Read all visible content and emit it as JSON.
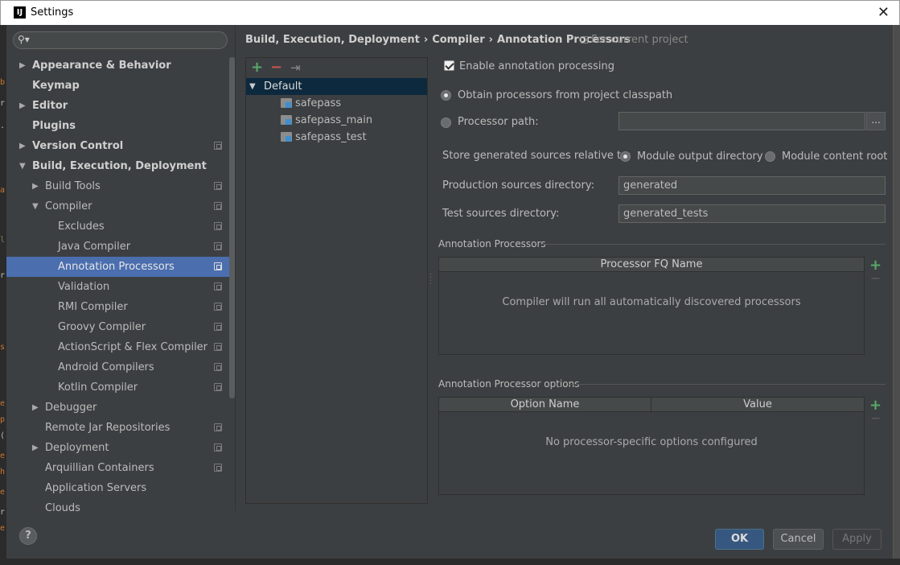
{
  "window": {
    "title": "Settings",
    "app_icon_letter": "IJ",
    "close_glyph": "✕"
  },
  "search": {
    "value": "",
    "placeholder": ""
  },
  "sidebar": {
    "items": [
      {
        "label": "Appearance & Behavior",
        "level": 0,
        "arrow": "▶",
        "bold": true,
        "project": false
      },
      {
        "label": "Keymap",
        "level": 0,
        "arrow": "",
        "bold": true,
        "project": false
      },
      {
        "label": "Editor",
        "level": 0,
        "arrow": "▶",
        "bold": true,
        "project": false
      },
      {
        "label": "Plugins",
        "level": 0,
        "arrow": "",
        "bold": true,
        "project": false
      },
      {
        "label": "Version Control",
        "level": 0,
        "arrow": "▶",
        "bold": true,
        "project": true
      },
      {
        "label": "Build, Execution, Deployment",
        "level": 0,
        "arrow": "▼",
        "bold": true,
        "project": false
      },
      {
        "label": "Build Tools",
        "level": 1,
        "arrow": "▶",
        "bold": false,
        "project": true
      },
      {
        "label": "Compiler",
        "level": 1,
        "arrow": "▼",
        "bold": false,
        "project": true
      },
      {
        "label": "Excludes",
        "level": 2,
        "arrow": "",
        "bold": false,
        "project": true
      },
      {
        "label": "Java Compiler",
        "level": 2,
        "arrow": "",
        "bold": false,
        "project": true
      },
      {
        "label": "Annotation Processors",
        "level": 2,
        "arrow": "",
        "bold": false,
        "project": true,
        "selected": true
      },
      {
        "label": "Validation",
        "level": 2,
        "arrow": "",
        "bold": false,
        "project": true
      },
      {
        "label": "RMI Compiler",
        "level": 2,
        "arrow": "",
        "bold": false,
        "project": true
      },
      {
        "label": "Groovy Compiler",
        "level": 2,
        "arrow": "",
        "bold": false,
        "project": true
      },
      {
        "label": "ActionScript & Flex Compiler",
        "level": 2,
        "arrow": "",
        "bold": false,
        "project": true
      },
      {
        "label": "Android Compilers",
        "level": 2,
        "arrow": "",
        "bold": false,
        "project": true
      },
      {
        "label": "Kotlin Compiler",
        "level": 2,
        "arrow": "",
        "bold": false,
        "project": true
      },
      {
        "label": "Debugger",
        "level": 1,
        "arrow": "▶",
        "bold": false,
        "project": false
      },
      {
        "label": "Remote Jar Repositories",
        "level": 1,
        "arrow": "",
        "bold": false,
        "project": true
      },
      {
        "label": "Deployment",
        "level": 1,
        "arrow": "▶",
        "bold": false,
        "project": true
      },
      {
        "label": "Arquillian Containers",
        "level": 1,
        "arrow": "",
        "bold": false,
        "project": true
      },
      {
        "label": "Application Servers",
        "level": 1,
        "arrow": "",
        "bold": false,
        "project": false
      },
      {
        "label": "Clouds",
        "level": 1,
        "arrow": "",
        "bold": false,
        "project": false
      }
    ]
  },
  "breadcrumb": {
    "parts": [
      "Build, Execution, Deployment",
      "Compiler",
      "Annotation Processors"
    ],
    "separator": "›",
    "scope": "For current project"
  },
  "profiles": {
    "toolbar": {
      "add": "+",
      "remove": "−",
      "move": "⇥"
    },
    "items": [
      {
        "label": "Default",
        "arrow": "▼",
        "level": 0,
        "selected": true
      },
      {
        "label": "safepass",
        "arrow": "",
        "level": 1
      },
      {
        "label": "safepass_main",
        "arrow": "",
        "level": 1
      },
      {
        "label": "safepass_test",
        "arrow": "",
        "level": 1
      }
    ]
  },
  "form": {
    "enable_label": "Enable annotation processing",
    "enable_checked": true,
    "obtain_label": "Obtain processors from project classpath",
    "processor_path_label": "Processor path:",
    "processor_path_value": "",
    "browse_label": "...",
    "store_label": "Store generated sources relative to:",
    "module_output_label": "Module output directory",
    "module_content_label": "Module content root",
    "production_label": "Production sources directory:",
    "production_value": "generated",
    "test_label": "Test sources directory:",
    "test_value": "generated_tests"
  },
  "processors_group": {
    "title": "Annotation Processors",
    "column": "Processor FQ Name",
    "empty": "Compiler will run all automatically discovered processors",
    "add": "+",
    "remove": "−"
  },
  "options_group": {
    "title": "Annotation Processor options",
    "columns": [
      "Option Name",
      "Value"
    ],
    "empty": "No processor-specific options configured",
    "add": "+",
    "remove": "−"
  },
  "buttons": {
    "help": "?",
    "ok": "OK",
    "cancel": "Cancel",
    "apply": "Apply"
  },
  "colors": {
    "selection": "#4b6eaf",
    "profile_selection": "#0d293e",
    "add_green": "#59a869",
    "remove_red": "#c75450",
    "background": "#3c3f41"
  },
  "left_strip": [
    "b",
    "r",
    ".",
    "a",
    "l",
    "r",
    "s",
    "e",
    "p",
    "(",
    "e",
    "h",
    "e",
    "r",
    "e"
  ]
}
